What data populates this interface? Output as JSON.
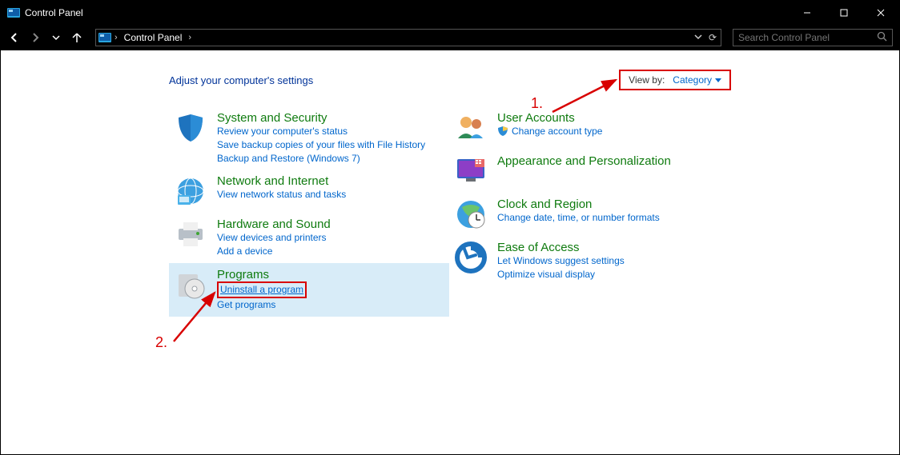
{
  "window": {
    "title": "Control Panel"
  },
  "address": {
    "location": "Control Panel"
  },
  "search": {
    "placeholder": "Search Control Panel"
  },
  "heading": "Adjust your computer's settings",
  "viewby": {
    "label": "View by:",
    "value": "Category"
  },
  "left": [
    {
      "title": "System and Security",
      "links": [
        "Review your computer's status",
        "Save backup copies of your files with File History",
        "Backup and Restore (Windows 7)"
      ]
    },
    {
      "title": "Network and Internet",
      "links": [
        "View network status and tasks"
      ]
    },
    {
      "title": "Hardware and Sound",
      "links": [
        "View devices and printers",
        "Add a device"
      ]
    },
    {
      "title": "Programs",
      "links": [
        "Uninstall a program",
        "Get programs"
      ]
    }
  ],
  "right": [
    {
      "title": "User Accounts",
      "links": [
        "Change account type"
      ],
      "shield": true
    },
    {
      "title": "Appearance and Personalization",
      "links": []
    },
    {
      "title": "Clock and Region",
      "links": [
        "Change date, time, or number formats"
      ]
    },
    {
      "title": "Ease of Access",
      "links": [
        "Let Windows suggest settings",
        "Optimize visual display"
      ]
    }
  ],
  "annotations": {
    "one": "1.",
    "two": "2."
  }
}
